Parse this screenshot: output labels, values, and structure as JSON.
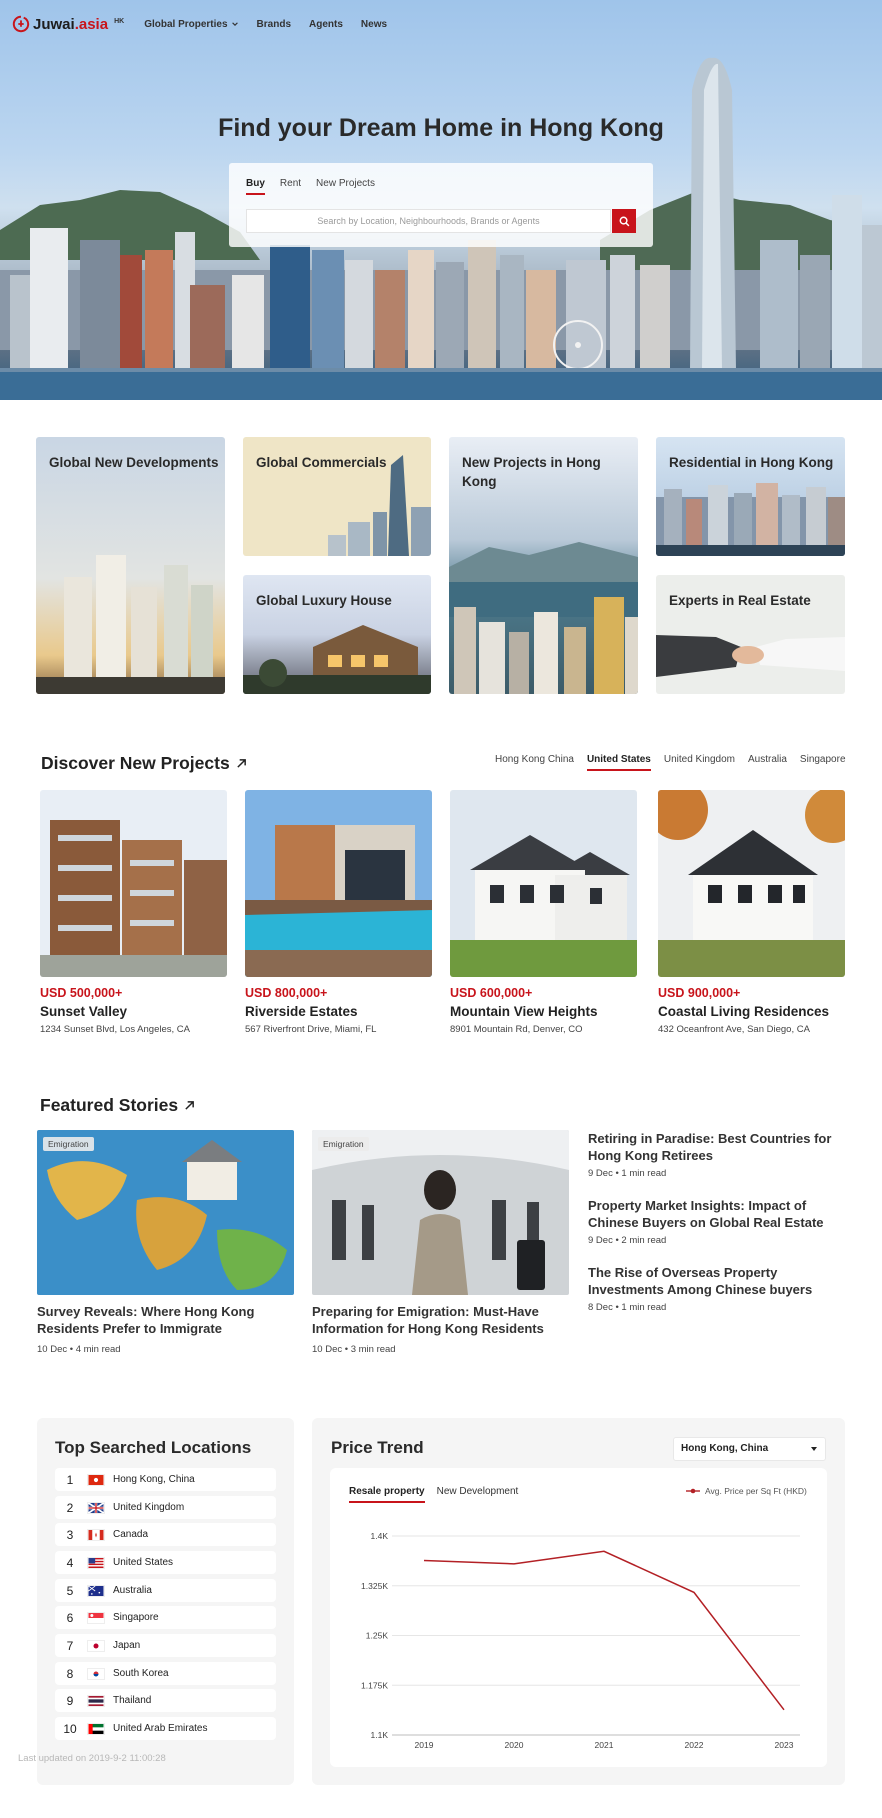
{
  "header": {
    "logo_text_main": "Juwai",
    "logo_text_accent": ".asia",
    "region": "HK",
    "nav": [
      "Global Properties",
      "Brands",
      "Agents",
      "News"
    ]
  },
  "hero": {
    "title": "Find your Dream Home in Hong Kong",
    "tabs": [
      "Buy",
      "Rent",
      "New Projects"
    ],
    "active_tab": "Buy",
    "search_placeholder": "Search by Location, Neighbourhoods, Brands or Agents"
  },
  "categories": [
    {
      "label": "Global New Developments"
    },
    {
      "label": "Global Commercials"
    },
    {
      "label": "New Projects in Hong Kong"
    },
    {
      "label": "Residential in Hong Kong"
    },
    {
      "label": "Global Luxury House"
    },
    {
      "label": "Experts in Real Estate"
    }
  ],
  "discover": {
    "title": "Discover New Projects",
    "regions": [
      "Hong Kong China",
      "United States",
      "United Kingdom",
      "Australia",
      "Singapore"
    ],
    "active_region": "United States",
    "projects": [
      {
        "price": "USD 500,000+",
        "name": "Sunset Valley",
        "address": "1234 Sunset Blvd, Los Angeles, CA"
      },
      {
        "price": "USD 800,000+",
        "name": "Riverside Estates",
        "address": "567 Riverfront Drive, Miami, FL"
      },
      {
        "price": "USD 600,000+",
        "name": "Mountain View Heights",
        "address": "8901 Mountain Rd, Denver, CO"
      },
      {
        "price": "USD 900,000+",
        "name": "Coastal Living Residences",
        "address": "432 Oceanfront Ave, San Diego, CA"
      }
    ]
  },
  "stories": {
    "title": "Featured Stories",
    "featured": [
      {
        "badge": "Emigration",
        "title_line1": "Survey Reveals: Where Hong Kong",
        "title_line2": "Residents Prefer to Immigrate",
        "meta": "10 Dec • 4 min read"
      },
      {
        "badge": "Emigration",
        "title_line1": "Preparing for Emigration: Must-Have",
        "title_line2": "Information for Hong Kong Residents",
        "meta": "10 Dec • 3 min read"
      }
    ],
    "side": [
      {
        "title_line1": "Retiring in Paradise: Best Countries for",
        "title_line2": "Hong Kong Retirees",
        "meta": "9 Dec • 1 min read"
      },
      {
        "title_line1": "Property Market Insights: Impact of",
        "title_line2": "Chinese Buyers on Global Real Estate",
        "meta": "9 Dec • 2 min read"
      },
      {
        "title_line1": "The Rise of Overseas Property",
        "title_line2": "Investments Among Chinese buyers",
        "meta": "8 Dec • 1 min read"
      }
    ]
  },
  "top_locations": {
    "title": "Top Searched Locations",
    "items": [
      {
        "rank": "1",
        "name": "Hong Kong, China",
        "flag": "hong-kong-flag"
      },
      {
        "rank": "2",
        "name": "United Kingdom",
        "flag": "uk-flag"
      },
      {
        "rank": "3",
        "name": "Canada",
        "flag": "canada-flag"
      },
      {
        "rank": "4",
        "name": "United States",
        "flag": "us-flag"
      },
      {
        "rank": "5",
        "name": "Australia",
        "flag": "australia-flag"
      },
      {
        "rank": "6",
        "name": "Singapore",
        "flag": "singapore-flag"
      },
      {
        "rank": "7",
        "name": "Japan",
        "flag": "japan-flag"
      },
      {
        "rank": "8",
        "name": "South Korea",
        "flag": "south-korea-flag"
      },
      {
        "rank": "9",
        "name": "Thailand",
        "flag": "thailand-flag"
      },
      {
        "rank": "10",
        "name": "United Arab Emirates",
        "flag": "uae-flag"
      }
    ],
    "last_updated": "Last updated on 2019-9-2 11:00:28"
  },
  "price_trend": {
    "title": "Price Trend",
    "selected_location": "Hong Kong, China",
    "tabs": [
      "Resale property",
      "New Development"
    ],
    "active_tab": "Resale property",
    "legend": "Avg. Price per Sq Ft (HKD)"
  },
  "chart_data": {
    "type": "line",
    "x": [
      "2019",
      "2020",
      "2021",
      "2022",
      "2023"
    ],
    "series": [
      {
        "name": "Avg. Price per Sq Ft (HKD)",
        "values": [
          1.363,
          1.358,
          1.377,
          1.315,
          1.138
        ]
      }
    ],
    "yticks": [
      "1.4K",
      "1.325K",
      "1.25K",
      "1.175K",
      "1.1K"
    ],
    "ylim": [
      1.1,
      1.4
    ],
    "grid": true,
    "color": "#b32025"
  },
  "colors": {
    "brand_red": "#c8141b",
    "panel_bg": "#f5f5f5"
  }
}
